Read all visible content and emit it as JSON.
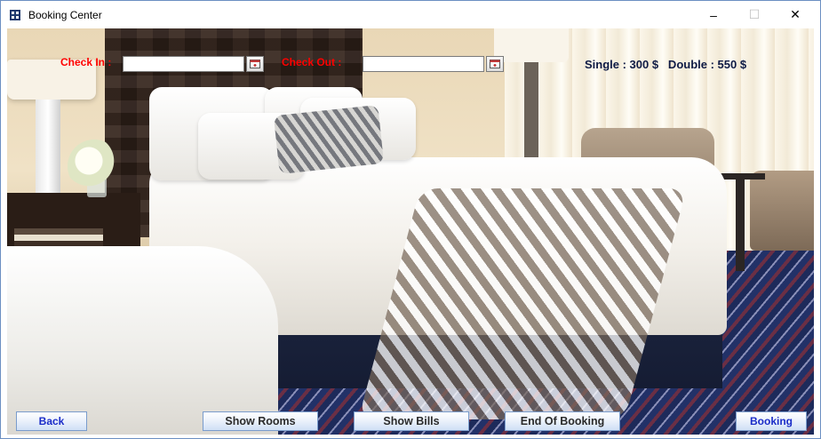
{
  "window": {
    "title": "Booking Center",
    "minimize_glyph": "–",
    "maximize_glyph": "☐",
    "close_glyph": "✕"
  },
  "form": {
    "check_in_label": "Check In :",
    "check_in_value": "",
    "check_out_label": "Check Out :",
    "check_out_value": ""
  },
  "prices": {
    "text": "Single : 300 $   Double : 550 $"
  },
  "buttons": {
    "back": "Back",
    "show_rooms": "Show Rooms",
    "show_bills": "Show Bills",
    "end_of_booking": "End Of Booking",
    "booking": "Booking"
  },
  "colors": {
    "label_red": "#ff0000",
    "button_text_blue": "#1a2cc8",
    "price_text": "#0e1a44"
  }
}
